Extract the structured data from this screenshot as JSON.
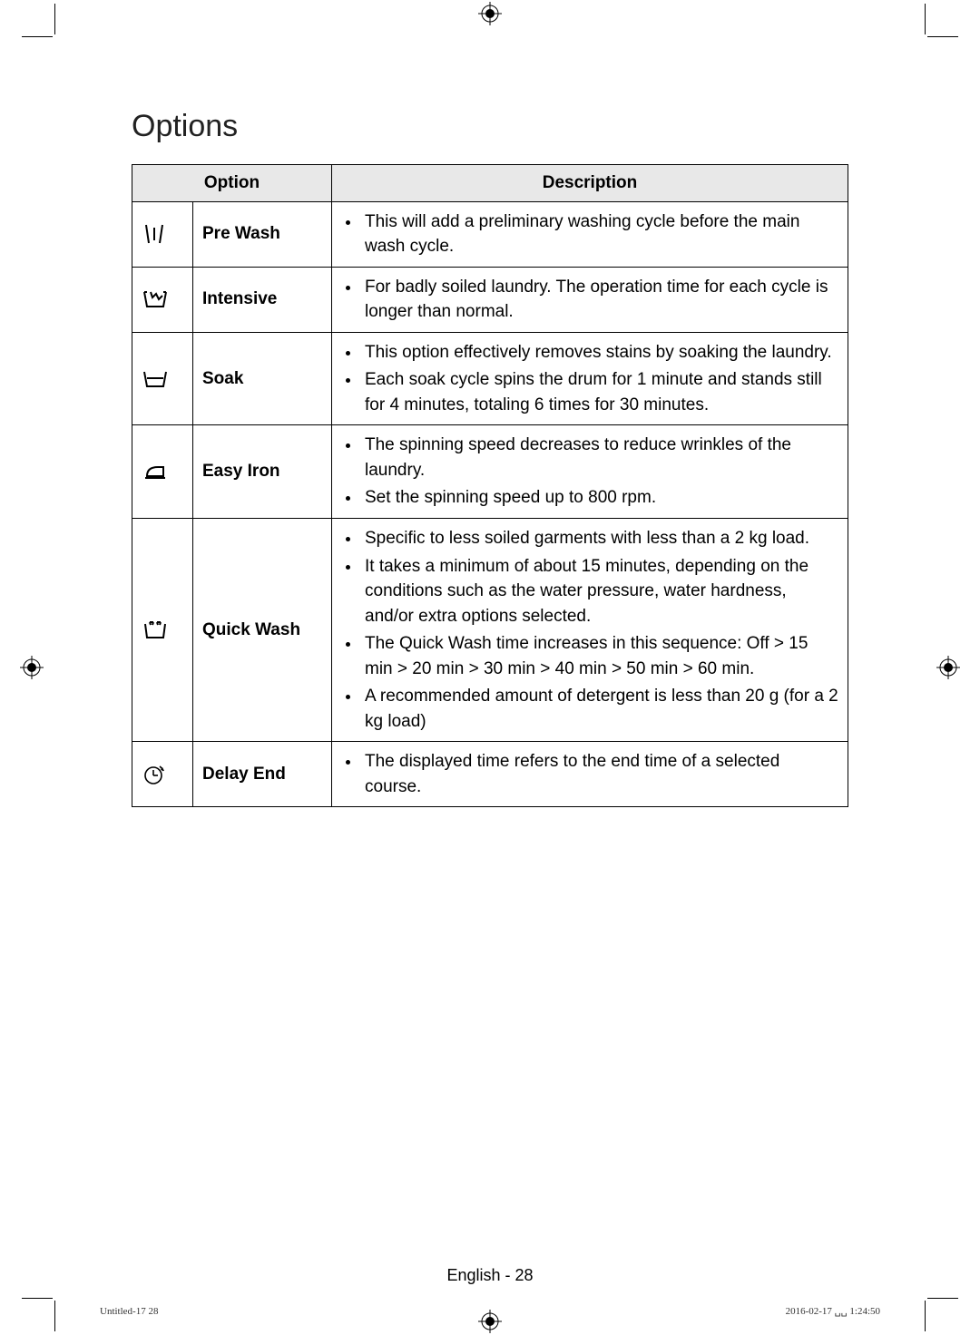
{
  "section_title": "Options",
  "table": {
    "header_option": "Option",
    "header_description": "Description",
    "rows": [
      {
        "name": "Pre Wash",
        "icon_name": "prewash-icon",
        "bullets": [
          "This will add a preliminary washing cycle before the main wash cycle."
        ]
      },
      {
        "name": "Intensive",
        "icon_name": "intensive-icon",
        "bullets": [
          "For badly soiled laundry. The operation time for each cycle is longer than normal."
        ]
      },
      {
        "name": "Soak",
        "icon_name": "soak-icon",
        "bullets": [
          "This option effectively removes stains by soaking the laundry.",
          "Each soak cycle spins the drum for 1 minute and stands still for 4 minutes, totaling 6 times for 30 minutes."
        ]
      },
      {
        "name": "Easy Iron",
        "icon_name": "easy-iron-icon",
        "bullets": [
          "The spinning speed decreases to reduce wrinkles of the laundry.",
          "Set the spinning speed up to 800 rpm."
        ]
      },
      {
        "name": "Quick Wash",
        "icon_name": "quick-wash-icon",
        "bullets": [
          "Specific to less soiled garments with less than a 2 kg load.",
          " It takes a minimum of about 15 minutes, depending on the conditions such as the water pressure, water hardness, and/or extra options selected.",
          "The Quick Wash time increases in this sequence: Off > 15 min > 20 min > 30 min > 40 min > 50 min > 60 min.",
          "A recommended amount of detergent is less than 20 g (for a 2 kg load)"
        ]
      },
      {
        "name": "Delay End",
        "icon_name": "delay-end-icon",
        "bullets": [
          "The displayed time refers to the end time of a selected course."
        ]
      }
    ]
  },
  "footer": {
    "center": "English - 28",
    "left": "Untitled-17   28",
    "right": "2016-02-17   ␣␣ 1:24:50"
  }
}
